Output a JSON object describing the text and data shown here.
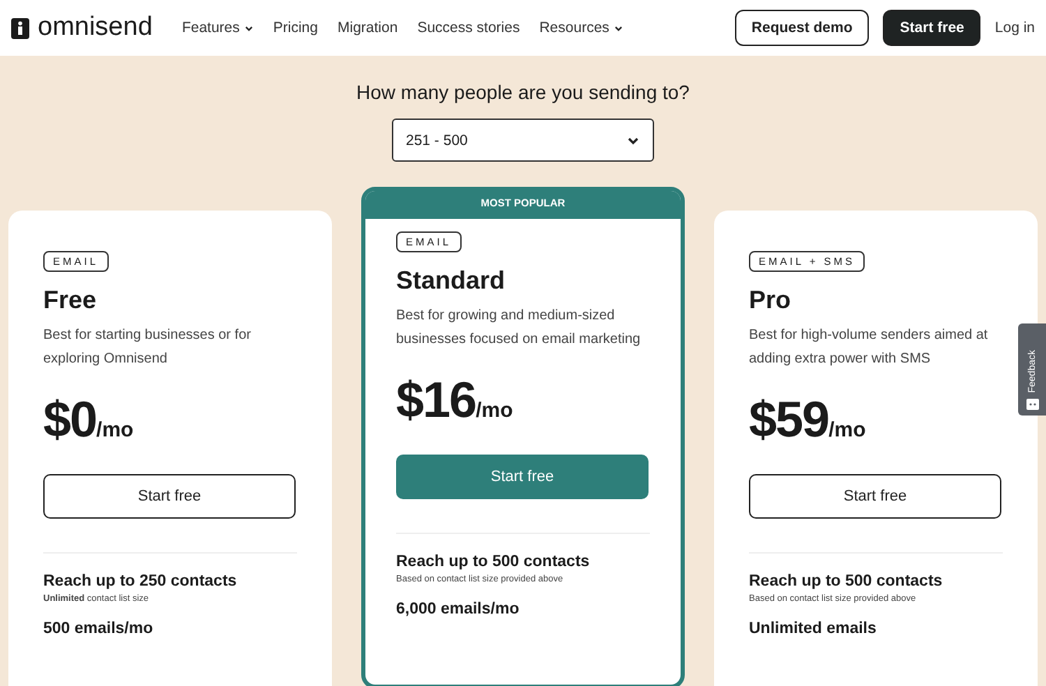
{
  "header": {
    "logo": "omnisend",
    "nav": [
      {
        "label": "Features",
        "dropdown": true
      },
      {
        "label": "Pricing",
        "dropdown": false
      },
      {
        "label": "Migration",
        "dropdown": false
      },
      {
        "label": "Success stories",
        "dropdown": false
      },
      {
        "label": "Resources",
        "dropdown": true
      }
    ],
    "request_demo": "Request demo",
    "start_free": "Start free",
    "login": "Log in"
  },
  "question": "How many people are you sending to?",
  "contacts_select": {
    "value": "251 - 500"
  },
  "plans": [
    {
      "badge": "EMAIL",
      "name": "Free",
      "description": "Best for starting businesses or for exploring Omnisend",
      "price": "$0",
      "period": "/mo",
      "button": "Start free",
      "popular": false,
      "features": [
        {
          "title": "Reach up to 250 contacts",
          "note": "**Unlimited** contact list size"
        },
        {
          "title": "500 emails/mo"
        }
      ]
    },
    {
      "popular_label": "MOST POPULAR",
      "badge": "EMAIL",
      "name": "Standard",
      "description": "Best for growing and medium-sized businesses focused on email marketing",
      "price": "$16",
      "period": "/mo",
      "button": "Start free",
      "popular": true,
      "features": [
        {
          "title": "Reach up to 500 contacts",
          "note": "Based on contact list size provided above"
        },
        {
          "title": "6,000 emails/mo"
        }
      ]
    },
    {
      "badge": "EMAIL + SMS",
      "name": "Pro",
      "description": "Best for high-volume senders aimed at adding extra power with SMS",
      "price": "$59",
      "period": "/mo",
      "button": "Start free",
      "popular": false,
      "features": [
        {
          "title": "Reach up to 500 contacts",
          "note": "Based on contact list size provided above"
        },
        {
          "title": "Unlimited emails"
        }
      ]
    }
  ],
  "feedback_tab": "Feedback"
}
